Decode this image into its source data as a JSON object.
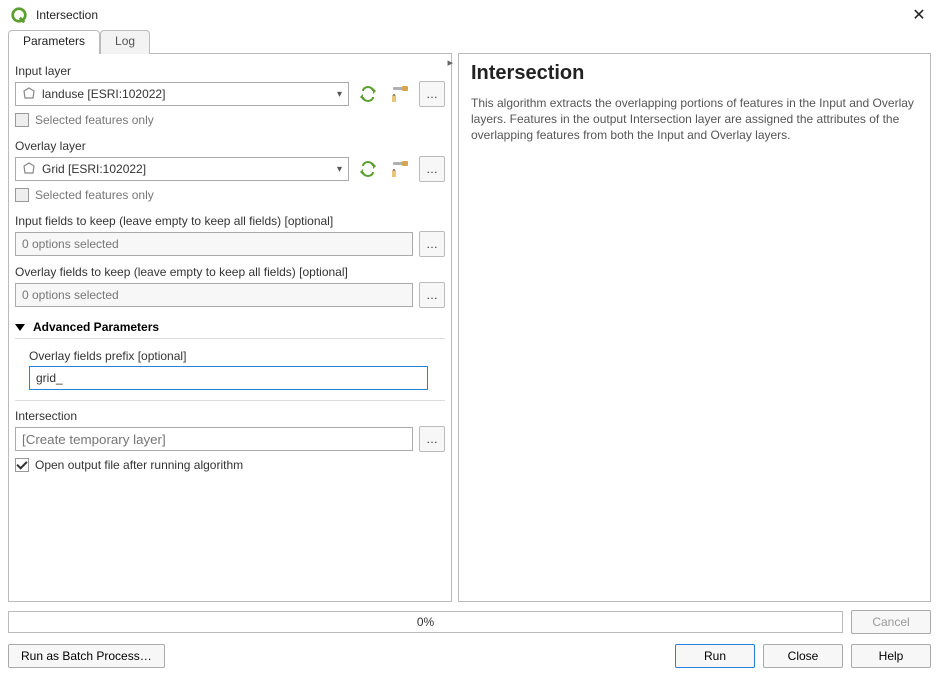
{
  "window": {
    "title": "Intersection"
  },
  "tabs": {
    "parameters": "Parameters",
    "log": "Log"
  },
  "params": {
    "input_label": "Input layer",
    "input_value": "landuse [ESRI:102022]",
    "input_selected_only": "Selected features only",
    "overlay_label": "Overlay layer",
    "overlay_value": "Grid [ESRI:102022]",
    "overlay_selected_only": "Selected features only",
    "input_fields_label": "Input fields to keep (leave empty to keep all fields) [optional]",
    "input_fields_value": "0 options selected",
    "overlay_fields_label": "Overlay fields to keep (leave empty to keep all fields) [optional]",
    "overlay_fields_value": "0 options selected",
    "advanced_title": "Advanced Parameters",
    "prefix_label": "Overlay fields prefix [optional]",
    "prefix_value": "grid_",
    "output_label": "Intersection",
    "output_placeholder": "[Create temporary layer]",
    "open_after": "Open output file after running algorithm"
  },
  "help": {
    "title": "Intersection",
    "body": "This algorithm extracts the overlapping portions of features in the Input and Overlay layers. Features in the output Intersection layer are assigned the attributes of the overlapping features from both the Input and Overlay layers."
  },
  "footer": {
    "progress": "0%",
    "cancel": "Cancel",
    "batch": "Run as Batch Process…",
    "run": "Run",
    "close": "Close",
    "help": "Help"
  },
  "icons": {
    "dots": "…"
  }
}
